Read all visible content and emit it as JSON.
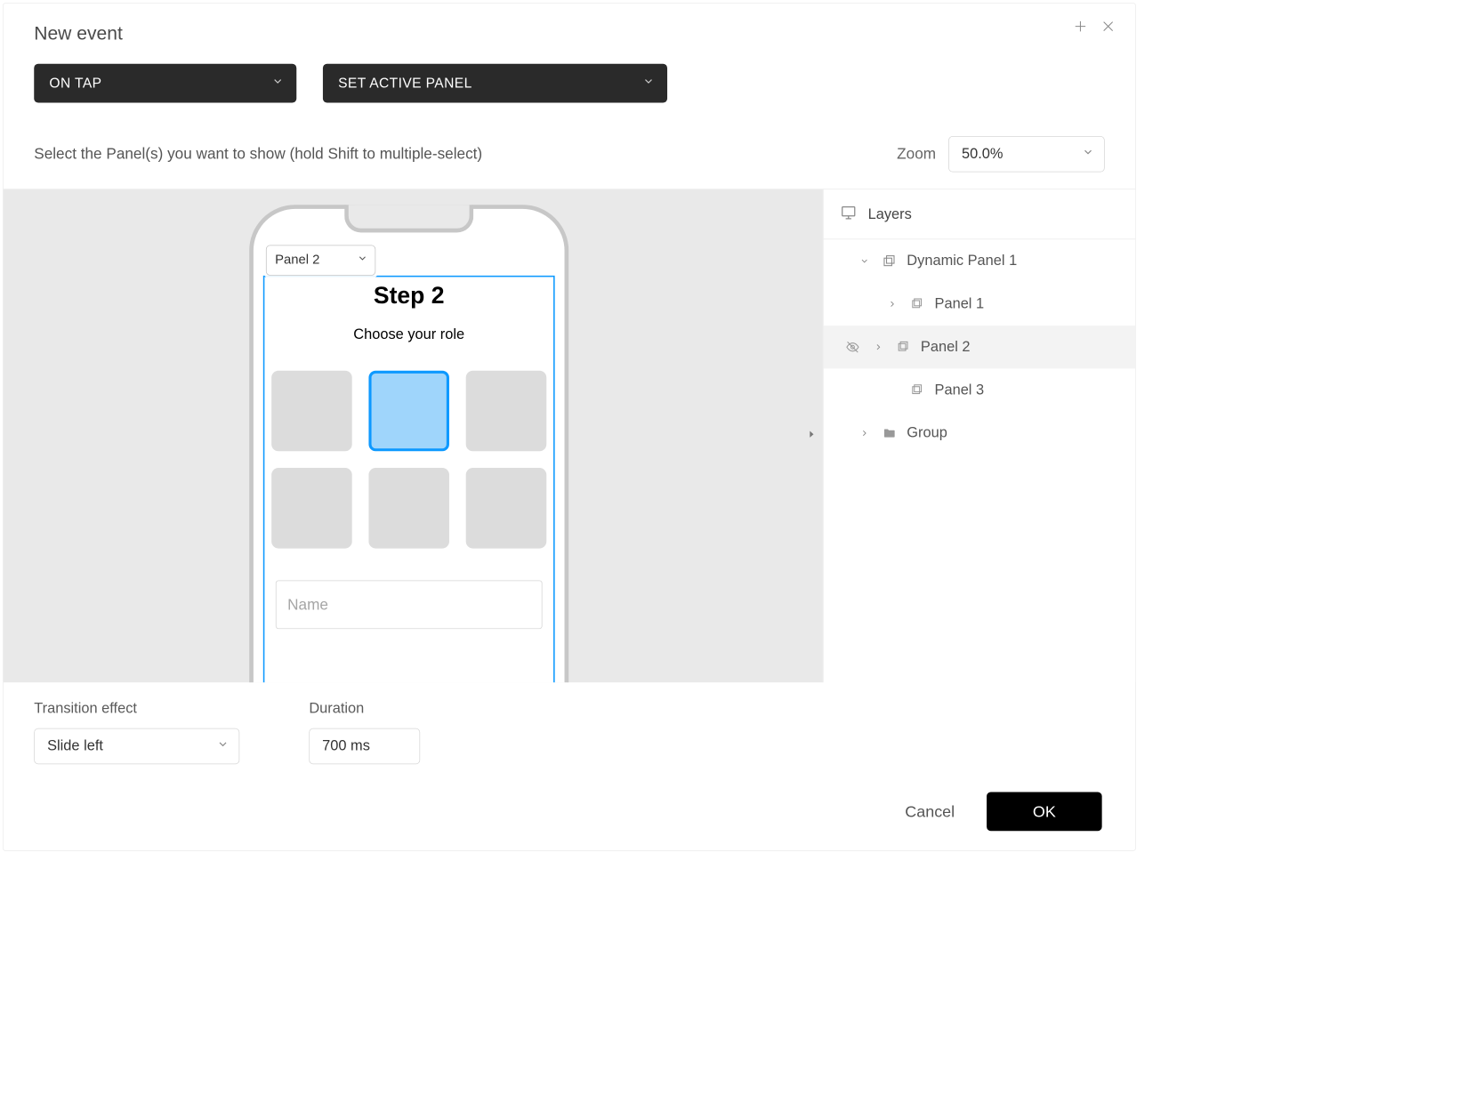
{
  "header": {
    "title": "New event"
  },
  "event": {
    "trigger": "ON TAP",
    "action": "SET ACTIVE PANEL"
  },
  "instruction": "Select the Panel(s) you want to show (hold Shift to multiple-select)",
  "zoom": {
    "label": "Zoom",
    "value": "50.0%"
  },
  "canvas": {
    "panel_selector": "Panel 2",
    "step_title": "Step 2",
    "step_subtitle": "Choose your role",
    "name_placeholder": "Name"
  },
  "layers": {
    "title": "Layers",
    "items": [
      {
        "name": "Dynamic Panel 1",
        "depth": 0,
        "expanded": true,
        "icon": "dynamic-panel",
        "selected": false
      },
      {
        "name": "Panel 1",
        "depth": 1,
        "expanded": false,
        "icon": "panel",
        "selected": false
      },
      {
        "name": "Panel 2",
        "depth": 1,
        "expanded": false,
        "icon": "panel",
        "selected": true,
        "hidden": true
      },
      {
        "name": "Panel 3",
        "depth": 1,
        "expanded": null,
        "icon": "panel",
        "selected": false
      },
      {
        "name": "Group",
        "depth": 0,
        "expanded": false,
        "icon": "folder",
        "selected": false
      }
    ]
  },
  "options": {
    "transition_label": "Transition effect",
    "transition_value": "Slide left",
    "duration_label": "Duration",
    "duration_value": "700 ms"
  },
  "actions": {
    "cancel": "Cancel",
    "ok": "OK"
  }
}
